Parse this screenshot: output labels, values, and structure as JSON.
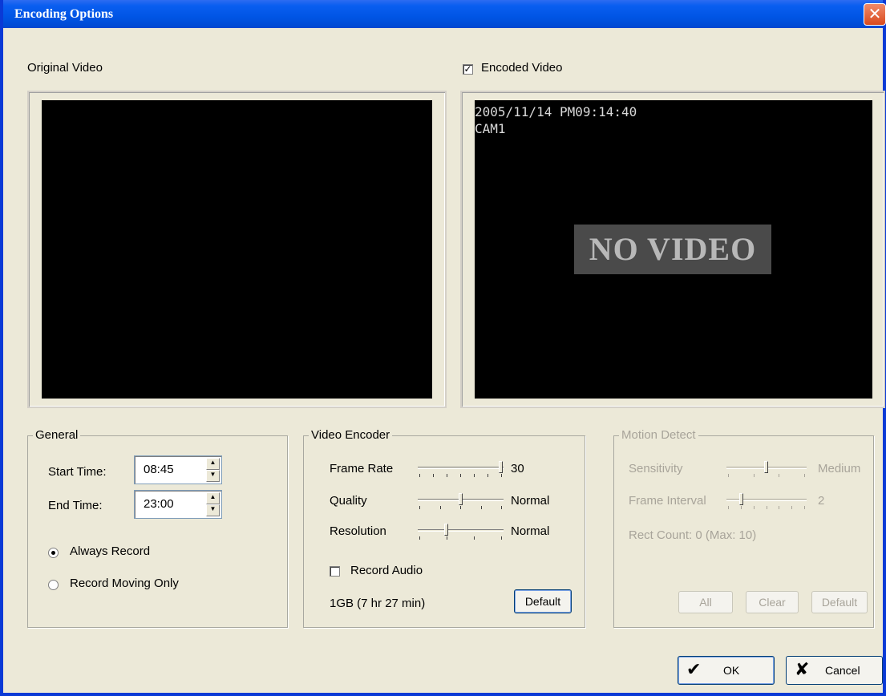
{
  "window": {
    "title": "Encoding Options",
    "close_glyph": "✕"
  },
  "original_video": {
    "label": "Original Video"
  },
  "encoded_video": {
    "label": "Encoded Video",
    "checked": true,
    "check_glyph": "✓",
    "osd_timestamp": "2005/11/14 PM09:14:40",
    "osd_camera": "CAM1",
    "no_video_text": "NO VIDEO"
  },
  "general": {
    "title": "General",
    "start_time_label": "Start Time:",
    "start_time_value": "08:45",
    "end_time_label": "End Time:",
    "end_time_value": "23:00",
    "spin_up": "▲",
    "spin_down": "▼",
    "always_record_label": "Always Record",
    "always_record_selected": true,
    "record_moving_label": "Record Moving Only",
    "record_moving_selected": false
  },
  "video_encoder": {
    "title": "Video Encoder",
    "frame_rate_label": "Frame Rate",
    "frame_rate_value": "30",
    "frame_rate_level": 1.0,
    "quality_label": "Quality",
    "quality_value": "Normal",
    "quality_level": 0.5,
    "resolution_label": "Resolution",
    "resolution_value": "Normal",
    "resolution_level": 0.33,
    "record_audio_label": "Record Audio",
    "record_audio_checked": false,
    "storage_text": "1GB (7 hr 27 min)",
    "default_button": "Default"
  },
  "motion_detect": {
    "title": "Motion Detect",
    "enabled": false,
    "sensitivity_label": "Sensitivity",
    "sensitivity_value": "Medium",
    "sensitivity_level": 0.5,
    "frame_interval_label": "Frame Interval",
    "frame_interval_value": "2",
    "frame_interval_level": 0.17,
    "rect_count_text": "Rect Count: 0  (Max: 10)",
    "all_button": "All",
    "clear_button": "Clear",
    "default_button": "Default"
  },
  "footer": {
    "ok_button": "OK",
    "ok_icon": "✔",
    "cancel_button": "Cancel",
    "cancel_icon": "✘"
  },
  "colors": {
    "titlebar": "#0055e5",
    "dialog_bg": "#ece9d8",
    "video_bg": "#000000",
    "disabled_text": "#a8a49a"
  }
}
